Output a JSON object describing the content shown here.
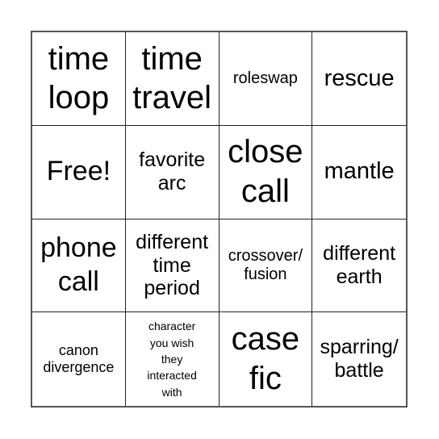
{
  "card": {
    "size": 4,
    "cells": [
      {
        "text": "time\nloop",
        "scale": "s-xl"
      },
      {
        "text": "time\ntravel",
        "scale": "s-xl"
      },
      {
        "text": "roleswap",
        "scale": "s-sm"
      },
      {
        "text": "rescue",
        "scale": "s-md"
      },
      {
        "text": "Free!",
        "scale": "s-lg",
        "free": true
      },
      {
        "text": "favorite\narc",
        "scale": "s-mdsm"
      },
      {
        "text": "close\ncall",
        "scale": "s-xl"
      },
      {
        "text": "mantle",
        "scale": "s-md"
      },
      {
        "text": "phone\ncall",
        "scale": "s-lg"
      },
      {
        "text": "different\ntime\nperiod",
        "scale": "s-mdsm"
      },
      {
        "text": "crossover/\nfusion",
        "scale": "s-sm"
      },
      {
        "text": "different\nearth",
        "scale": "s-mdsm"
      },
      {
        "text": "canon\ndivergence",
        "scale": "s-xs"
      },
      {
        "text": "character\nyou wish\nthey\ninteracted\nwith",
        "scale": "s-xxs"
      },
      {
        "text": "case\nfic",
        "scale": "s-xl"
      },
      {
        "text": "sparring/\nbattle",
        "scale": "s-mdsm"
      }
    ]
  }
}
